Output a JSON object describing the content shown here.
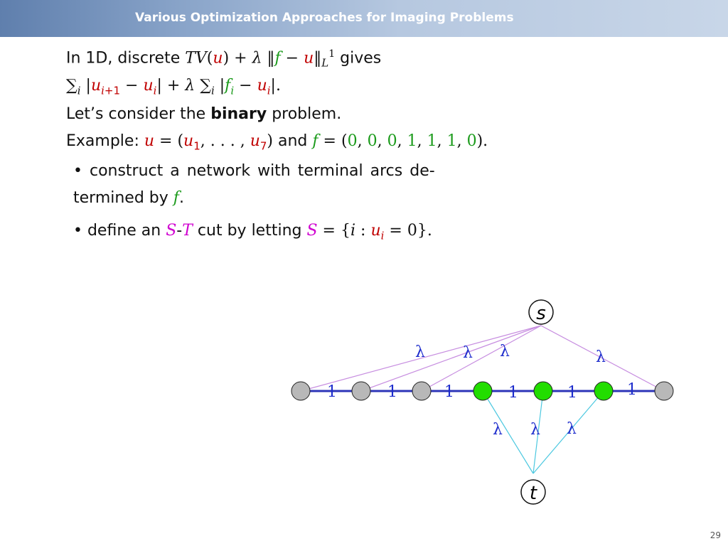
{
  "slide": {
    "title": "Various Optimization Approaches for Imaging Problems",
    "page_number": "29"
  },
  "text": {
    "line1_pre": "In 1D, discrete ",
    "line1_tv": "TV",
    "line1_post": " gives",
    "line3_pre": "Let’s consider the ",
    "line3_bold": "binary",
    "line3_post": " problem.",
    "line4_pre": "Example: ",
    "bullet1_a": "• construct a network with terminal arcs de-",
    "bullet1_b_pre": "termined by ",
    "bullet2_pre": "• define an ",
    "bullet2_mid": " cut by letting "
  },
  "diagram": {
    "source_label": "s",
    "sink_label": "t",
    "lambda_symbol": "λ",
    "chain_weight": "1",
    "nodes": [
      {
        "id": "u1",
        "color": "gray"
      },
      {
        "id": "u2",
        "color": "gray"
      },
      {
        "id": "u3",
        "color": "gray"
      },
      {
        "id": "u4",
        "color": "green"
      },
      {
        "id": "u5",
        "color": "green"
      },
      {
        "id": "u6",
        "color": "green"
      },
      {
        "id": "u7",
        "color": "gray"
      }
    ],
    "colors": {
      "gray_node": "#b8b8b8",
      "green_node": "#22dd00",
      "chain": "#2c34b8",
      "source_arc": "#c78ee0",
      "sink_arc": "#4cc8e0",
      "label": "#1d2ccc"
    }
  }
}
